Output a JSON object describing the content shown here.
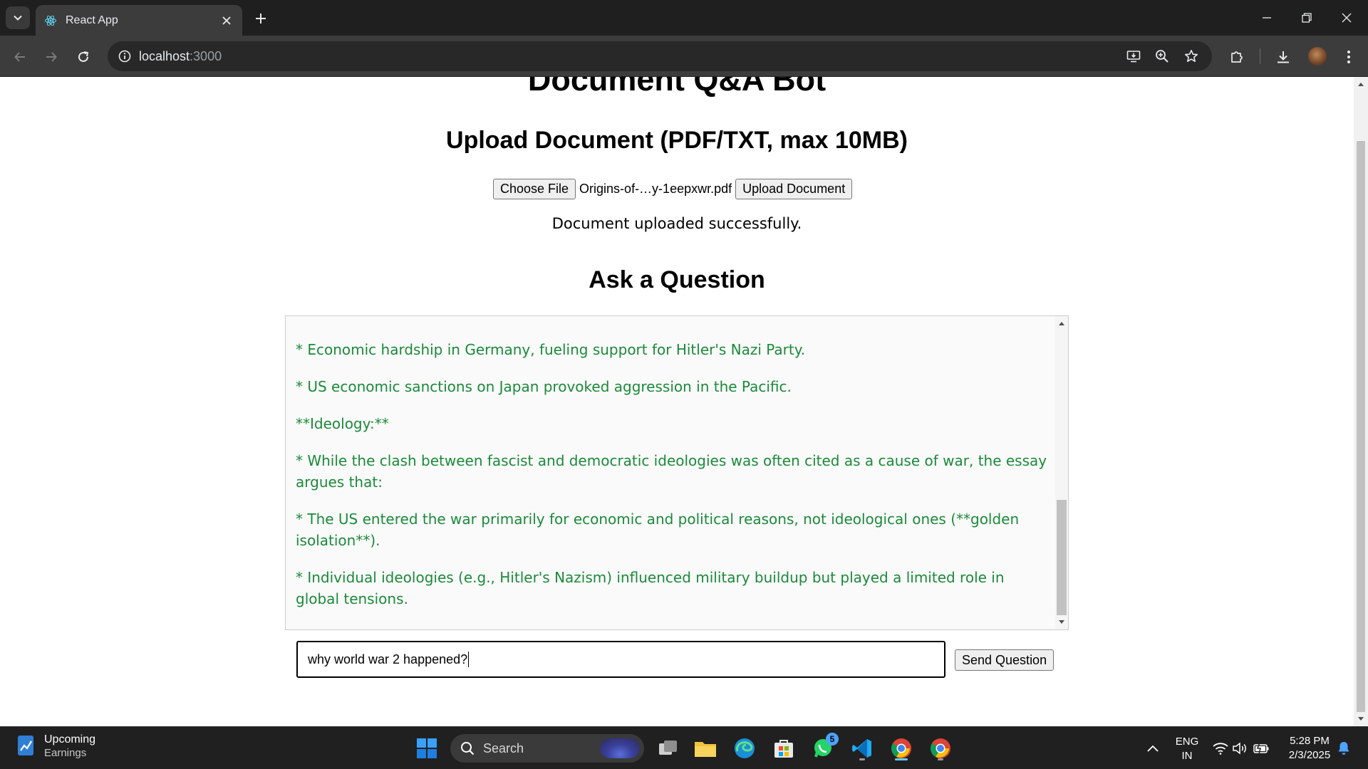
{
  "browser": {
    "tab_title": "React App",
    "url_host": "localhost",
    "url_port": ":3000"
  },
  "page": {
    "title": "Document Q&A Bot",
    "upload_heading": "Upload Document (PDF/TXT, max 10MB)",
    "choose_file_label": "Choose File",
    "file_name": "Origins-of-…y-1eepxwr.pdf",
    "upload_button_label": "Upload Document",
    "upload_status": "Document uploaded successfully.",
    "question_heading": "Ask a Question",
    "answer_paragraphs": [
      "* Economic hardship in Germany, fueling support for Hitler's Nazi Party.",
      "* US economic sanctions on Japan provoked aggression in the Pacific.",
      "**Ideology:**",
      "* While the clash between fascist and democratic ideologies was often cited as a cause of war, the essay argues that:",
      "* The US entered the war primarily for economic and political reasons, not ideological ones (**golden isolation**).",
      "* Individual ideologies (e.g., Hitler's Nazism) influenced military buildup but played a limited role in global tensions."
    ],
    "question_value": "why world war 2 happened?",
    "send_button_label": "Send Question",
    "answer_color": "#1b8a3a"
  },
  "taskbar": {
    "widget_title": "Upcoming",
    "widget_subtitle": "Earnings",
    "search_label": "Search",
    "whatsapp_badge": "5",
    "language_line1": "ENG",
    "language_line2": "IN",
    "time": "5:28 PM",
    "date": "2/3/2025"
  }
}
